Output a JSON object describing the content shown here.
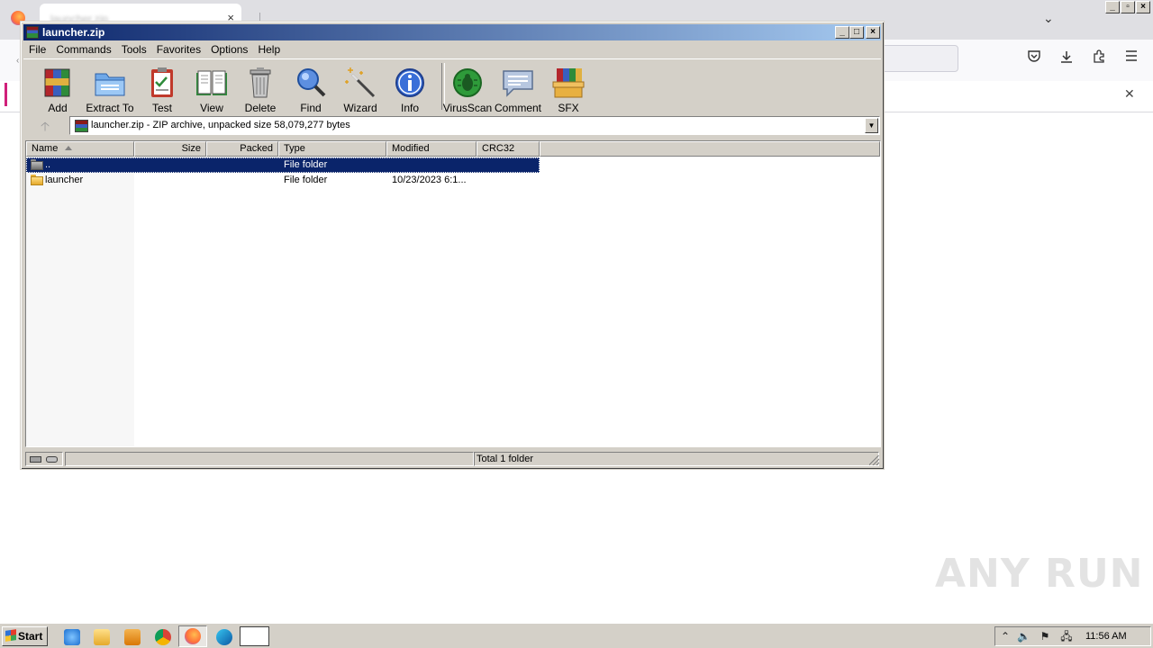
{
  "browser": {
    "tab_title": "launcher.zip",
    "tab_close": "×",
    "tab_list": "⌄",
    "notif_close": "✕",
    "toolbar_icons": [
      "pocket-icon",
      "download-icon",
      "extensions-icon",
      "menu-icon"
    ]
  },
  "winrar": {
    "title": "launcher.zip",
    "menu": [
      "File",
      "Commands",
      "Tools",
      "Favorites",
      "Options",
      "Help"
    ],
    "tools": [
      {
        "label": "Add",
        "icon": "add-archive-icon"
      },
      {
        "label": "Extract To",
        "icon": "extract-folder-icon"
      },
      {
        "label": "Test",
        "icon": "test-clipboard-icon"
      },
      {
        "label": "View",
        "icon": "view-book-icon"
      },
      {
        "label": "Delete",
        "icon": "trash-icon"
      },
      {
        "label": "Find",
        "icon": "magnifier-icon"
      },
      {
        "label": "Wizard",
        "icon": "magic-wand-icon"
      },
      {
        "label": "Info",
        "icon": "info-icon"
      },
      {
        "label": "VirusScan",
        "icon": "virus-bug-icon"
      },
      {
        "label": "Comment",
        "icon": "comment-icon"
      },
      {
        "label": "SFX",
        "icon": "sfx-box-icon"
      }
    ],
    "address": "launcher.zip - ZIP archive, unpacked size 58,079,277 bytes",
    "columns": [
      "Name",
      "Size",
      "Packed",
      "Type",
      "Modified",
      "CRC32"
    ],
    "rows": [
      {
        "name": "..",
        "size": "",
        "packed": "",
        "type": "File folder",
        "modified": "",
        "crc": "",
        "selected": true
      },
      {
        "name": "launcher",
        "size": "",
        "packed": "",
        "type": "File folder",
        "modified": "10/23/2023 6:1...",
        "crc": "",
        "selected": false
      }
    ],
    "status": "Total 1 folder"
  },
  "taskbar": {
    "start": "Start",
    "clock": "11:56 AM"
  },
  "watermark": "ANY RUN",
  "colors": {
    "title_gradient_start": "#0a246a",
    "title_gradient_end": "#a6caf0",
    "selection": "#0a246a",
    "window_face": "#d4d0c8"
  }
}
